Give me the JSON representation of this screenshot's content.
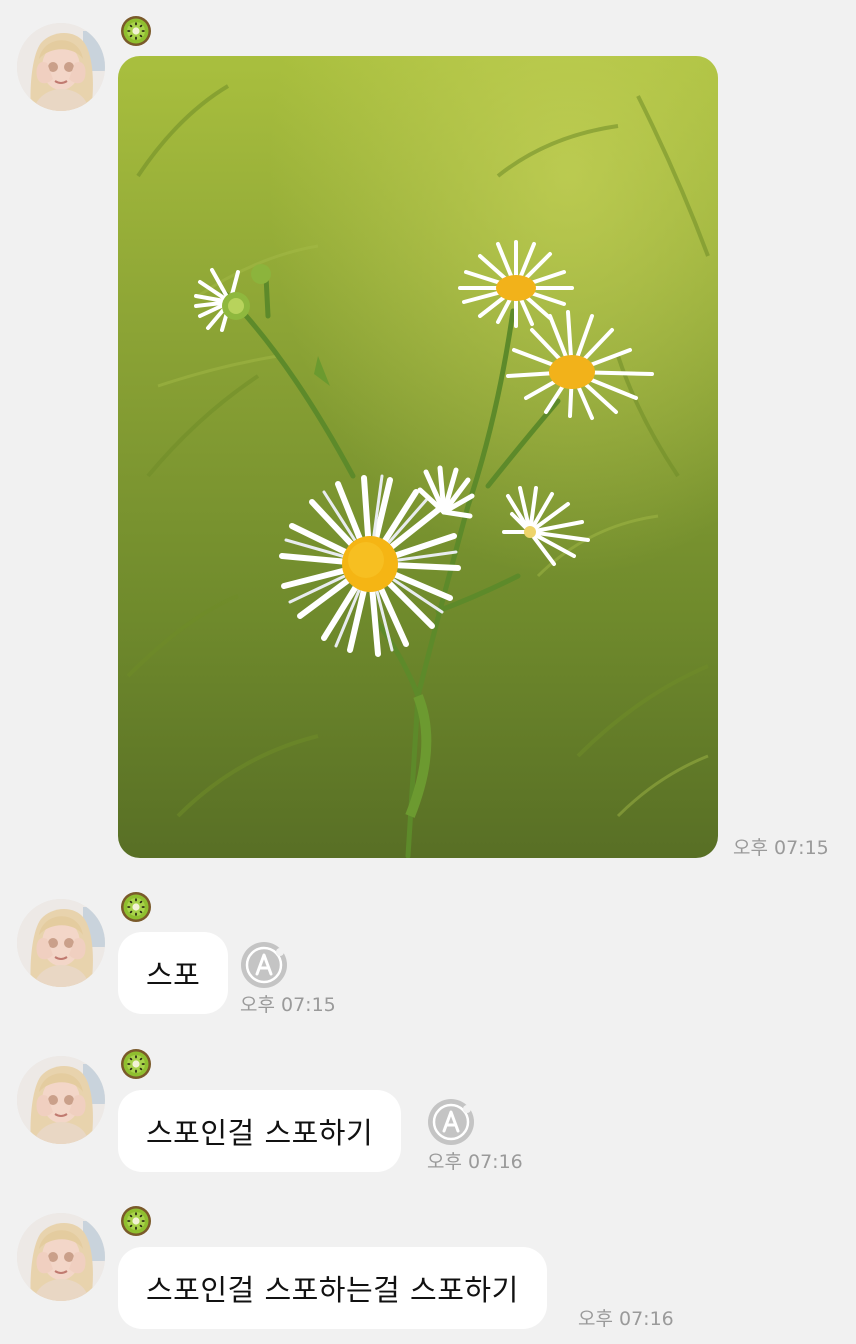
{
  "chat": {
    "messages": [
      {
        "type": "image",
        "time": "오후 07:15"
      },
      {
        "type": "text",
        "text": "스포",
        "time": "오후 07:15",
        "reaction": "A"
      },
      {
        "type": "text",
        "text": "스포인걸 스포하기",
        "time": "오후 07:16",
        "reaction": "A"
      },
      {
        "type": "text",
        "text": "스포인걸 스포하는걸 스포하기",
        "time": "오후 07:16"
      }
    ]
  },
  "colors": {
    "background": "#f1f1f1",
    "bubble": "#ffffff",
    "timestamp": "#9a9a9a",
    "reaction_icon": "#bdbdbd"
  },
  "icons": {
    "avatar": "profile-photo-avatar",
    "badge": "kiwi-icon",
    "reaction": "reaction-a-icon"
  }
}
